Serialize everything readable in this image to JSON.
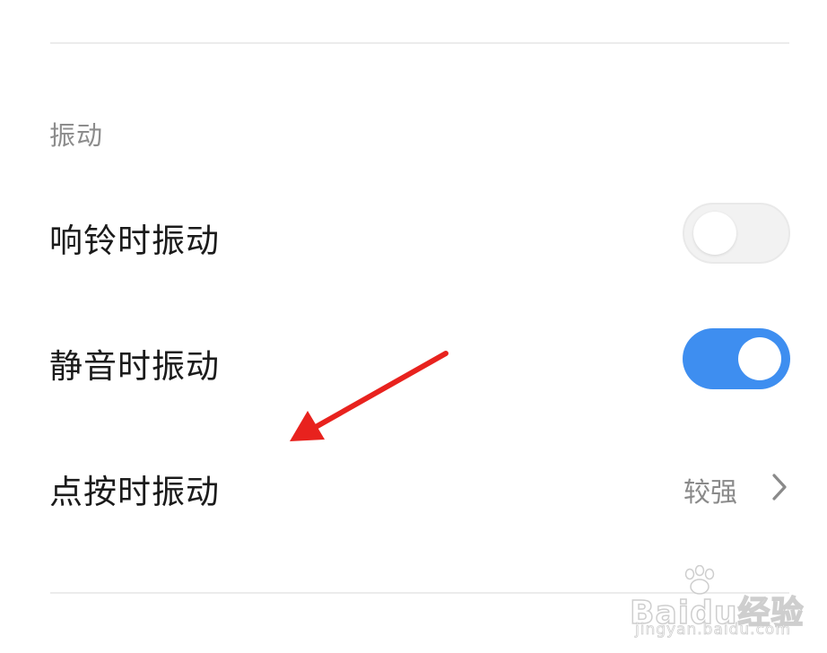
{
  "section": {
    "title": "振动"
  },
  "rows": [
    {
      "label": "响铃时振动",
      "control": "toggle",
      "on": false
    },
    {
      "label": "静音时振动",
      "control": "toggle",
      "on": true
    },
    {
      "label": "点按时振动",
      "control": "detail",
      "value": "较强",
      "icon": "chevron-right-icon"
    }
  ],
  "colors": {
    "accent": "#3e8ef0",
    "toggle_off": "#f2f2f2",
    "annotation": "#e8221e"
  },
  "watermark": {
    "brand": "Baidu经验",
    "url": "jingyan.baidu.com",
    "icon": "paw-icon"
  }
}
